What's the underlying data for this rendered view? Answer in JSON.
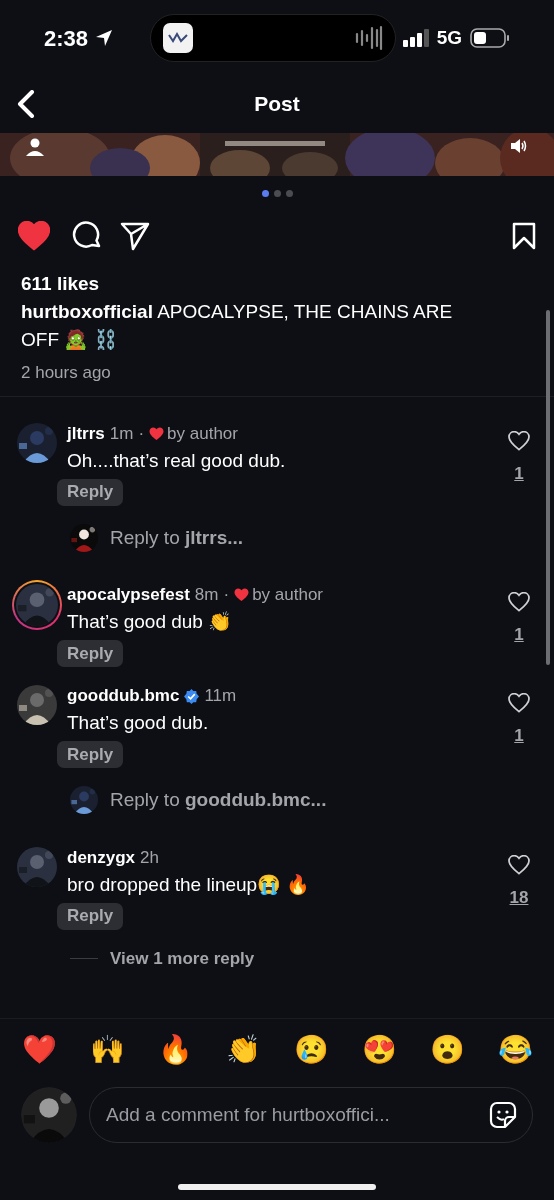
{
  "status_bar": {
    "time": "2:38",
    "network": "5G"
  },
  "nav": {
    "title": "Post"
  },
  "carousel": {
    "dots": [
      {
        "selected": true
      },
      {
        "selected": false
      },
      {
        "selected": false
      }
    ]
  },
  "actions": {
    "liked": true,
    "saved": false
  },
  "likes": "611 likes",
  "caption": {
    "user": "hurtboxofficial",
    "text": "APOCALYPSE, THE CHAINS ARE OFF 🧟 ⛓️"
  },
  "time_ago": "2 hours ago",
  "comments": [
    {
      "kind": "comment",
      "user": "jltrrs",
      "time": "1m",
      "separator": "·",
      "by_author": "by author",
      "story_ring": false,
      "verified": false,
      "text": "Oh....that’s real good dub.",
      "reply": "Reply",
      "liked": false,
      "like_count": "1"
    },
    {
      "kind": "reply_prompt",
      "text": "Reply to **jltrrs...**"
    },
    {
      "kind": "comment",
      "user": "apocalypsefest",
      "time": "8m",
      "separator": "·",
      "by_author": "by author",
      "story_ring": true,
      "verified": false,
      "text": "That’s good dub 👏",
      "reply": "Reply",
      "liked": false,
      "like_count": "1"
    },
    {
      "kind": "comment",
      "user": "gooddub.bmc",
      "time": "11m",
      "story_ring": false,
      "verified": true,
      "text": "That’s good dub.",
      "reply": "Reply",
      "liked": false,
      "like_count": "1"
    },
    {
      "kind": "reply_prompt",
      "text": "Reply to **gooddub.bmc...**"
    },
    {
      "kind": "comment",
      "user": "denzygx",
      "time": "2h",
      "story_ring": false,
      "verified": false,
      "text": "bro dropped the lineup😭 🔥",
      "reply": "Reply",
      "liked": false,
      "like_count": "18"
    },
    {
      "kind": "view_more",
      "text": "View 1 more reply"
    }
  ],
  "quick_reactions": [
    "❤️",
    "🙌",
    "🔥",
    "👏",
    "😢",
    "😍",
    "😮",
    "😂"
  ],
  "comment_field": {
    "placeholder": "Add a comment for hurtboxoffici..."
  }
}
